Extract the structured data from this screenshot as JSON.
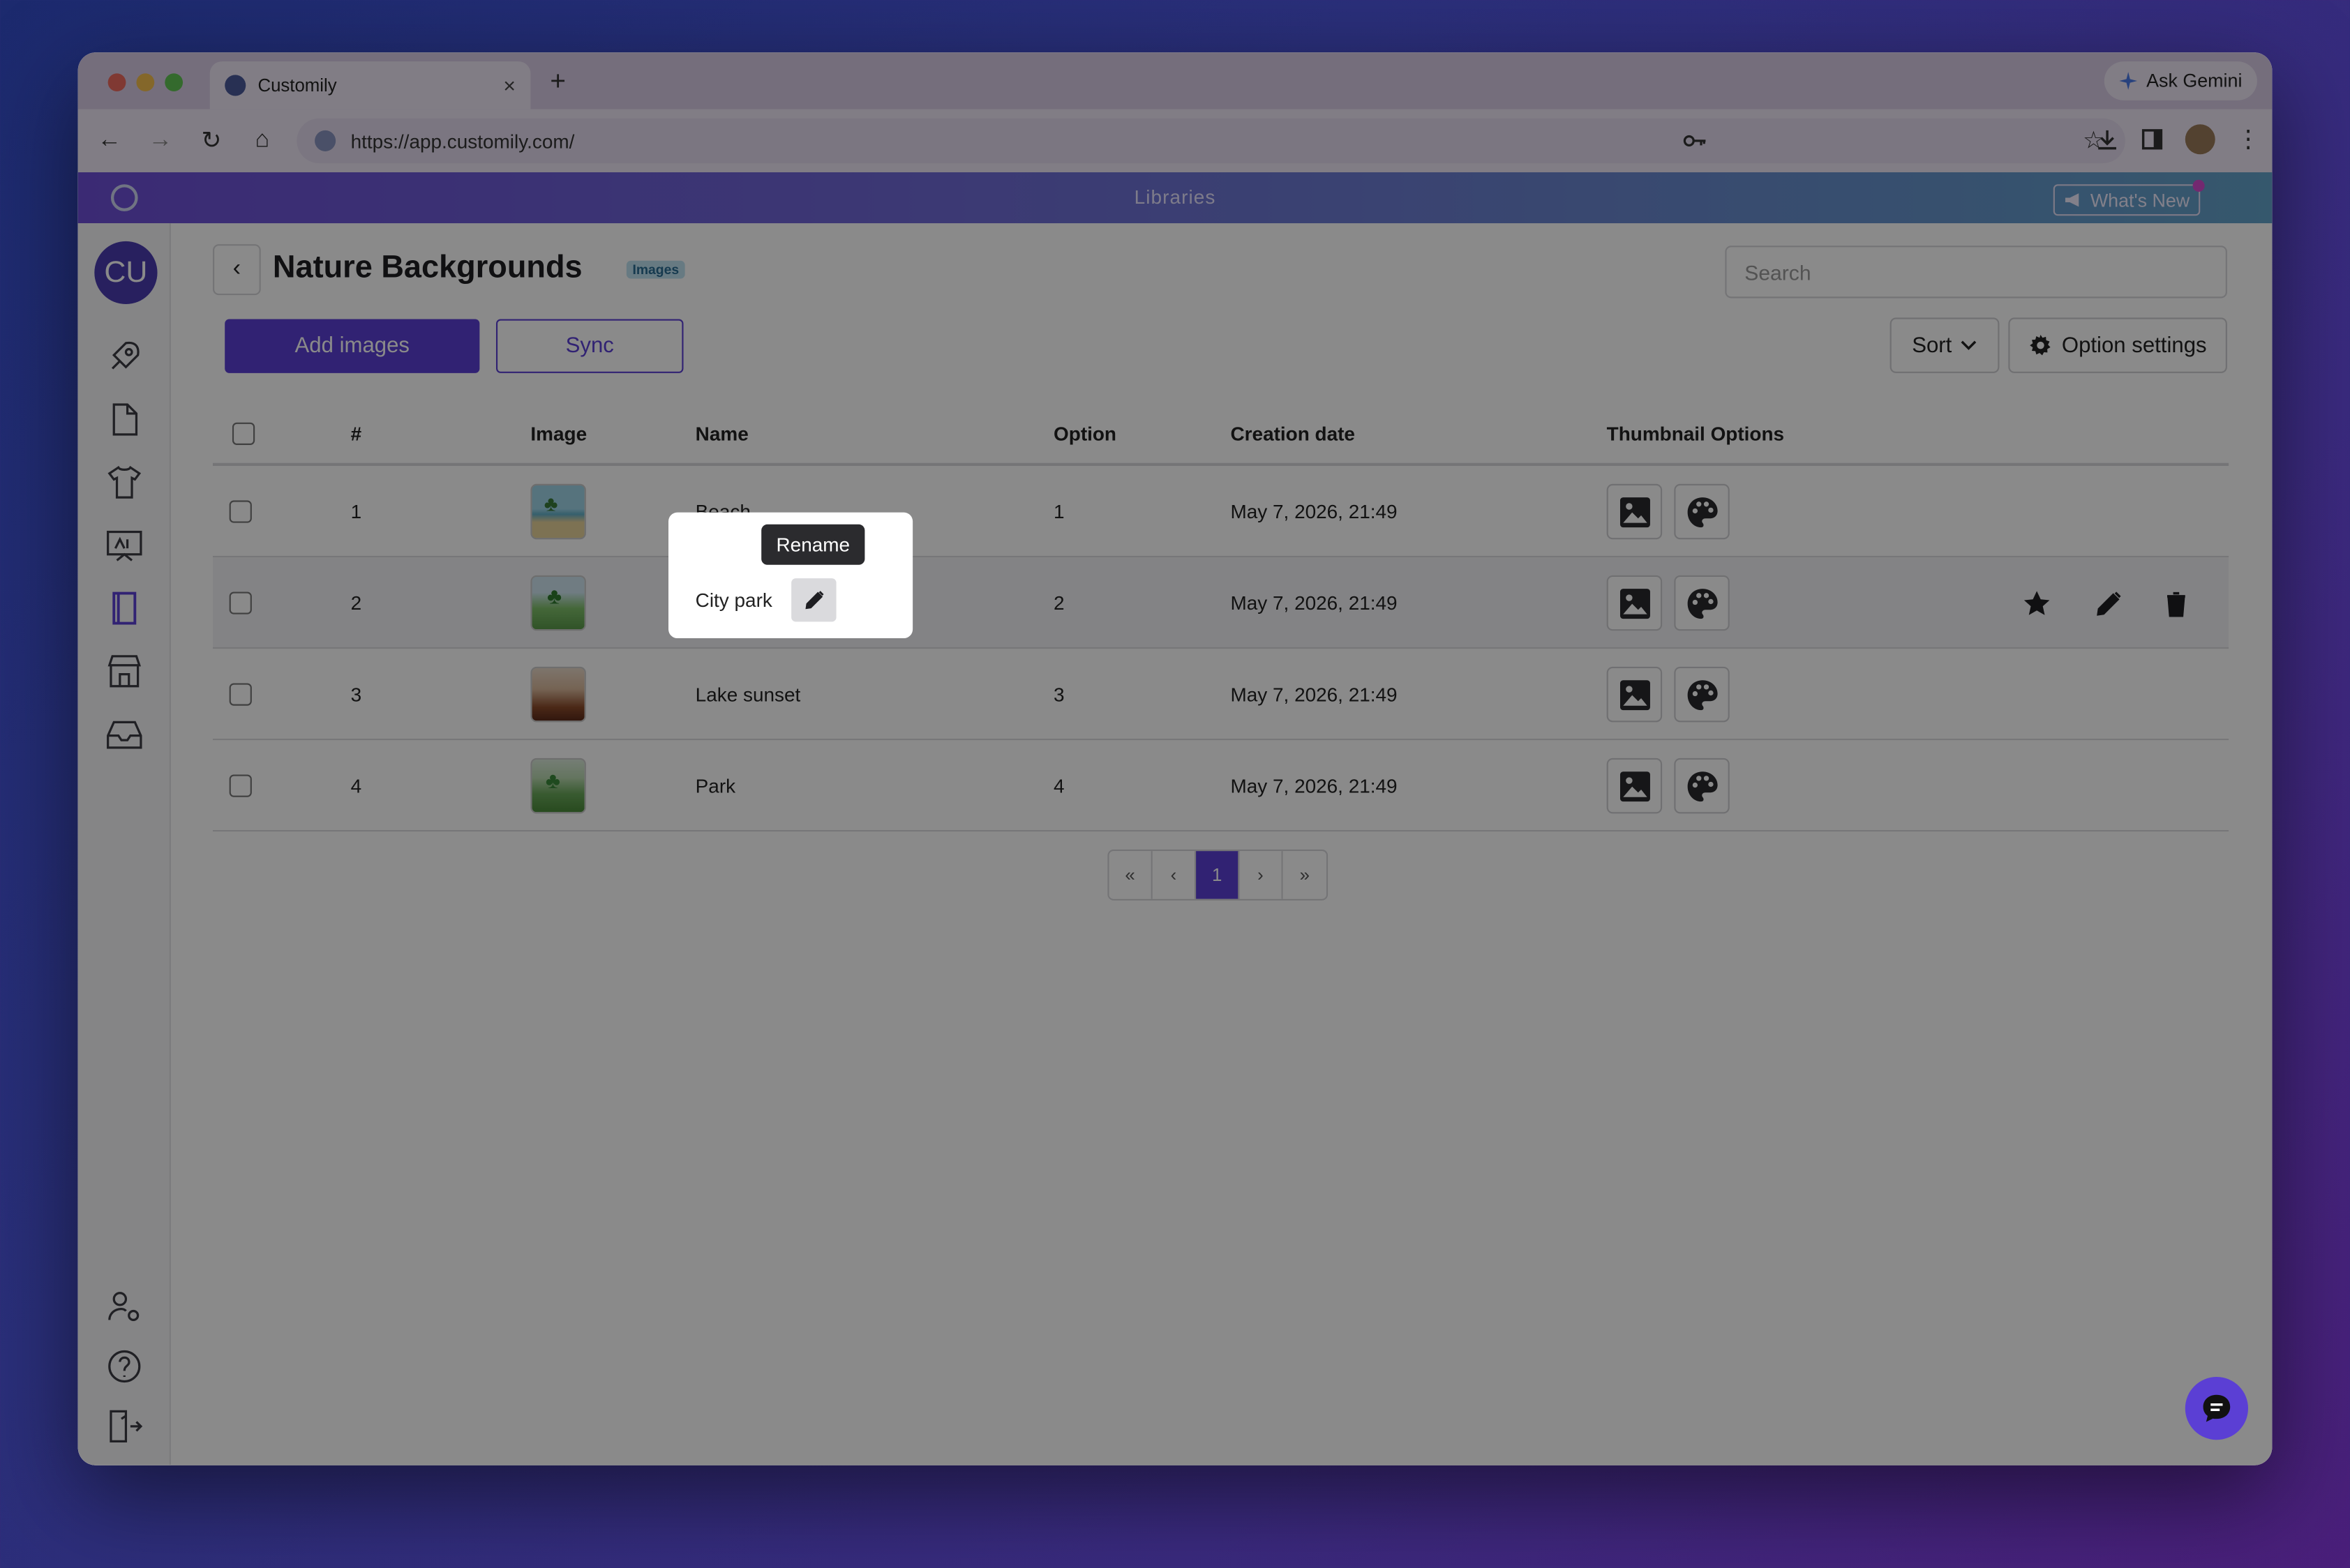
{
  "browser": {
    "tab_title": "Customily",
    "close_glyph": "×",
    "new_tab_glyph": "+",
    "gemini_label": "Ask Gemini",
    "url": "https://app.customily.com/",
    "traffic_colors": [
      "#ec6a5e",
      "#f4bf4f",
      "#61c554"
    ]
  },
  "app": {
    "banner_title": "Libraries",
    "whats_new_label": "What's New",
    "avatar_initials": "CU",
    "accent_color": "#5b3fd4"
  },
  "sidebar": {
    "top_icons": [
      "rocket-icon",
      "file-icon",
      "shirt-icon",
      "presentation-icon",
      "book-icon",
      "store-icon",
      "inbox-icon"
    ],
    "bottom_icons": [
      "user-settings-icon",
      "help-icon",
      "logout-icon"
    ]
  },
  "page": {
    "back_glyph": "‹",
    "title": "Nature Backgrounds",
    "badge": "Images",
    "search_placeholder": "Search",
    "add_images_label": "Add images",
    "sync_label": "Sync",
    "sort_label": "Sort",
    "option_settings_label": "Option settings"
  },
  "table": {
    "headers": {
      "number": "#",
      "image": "Image",
      "name": "Name",
      "option": "Option",
      "creation_date": "Creation date",
      "thumbnail_options": "Thumbnail Options"
    },
    "rows": [
      {
        "number": "1",
        "name": "Beach",
        "option": "1",
        "date": "May 7, 2026, 21:49"
      },
      {
        "number": "2",
        "name": "City park",
        "option": "2",
        "date": "May 7, 2026, 21:49"
      },
      {
        "number": "3",
        "name": "Lake sunset",
        "option": "3",
        "date": "May 7, 2026, 21:49"
      },
      {
        "number": "4",
        "name": "Park",
        "option": "4",
        "date": "May 7, 2026, 21:49"
      }
    ]
  },
  "pager": {
    "first": "«",
    "prev": "‹",
    "current": "1",
    "next": "›",
    "last": "»"
  },
  "tooltip": {
    "text": "Rename"
  }
}
